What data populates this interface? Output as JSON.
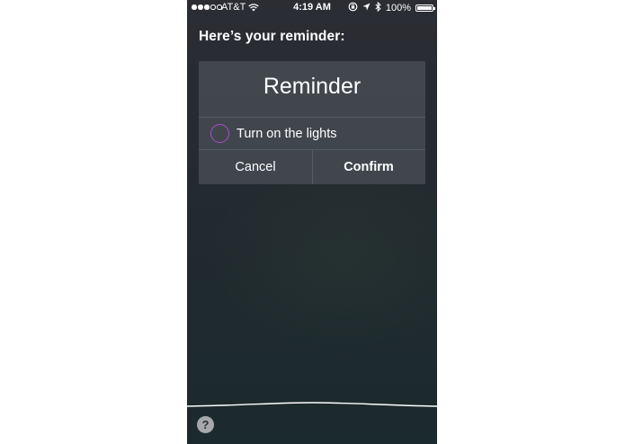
{
  "status_bar": {
    "carrier": "AT&T",
    "time": "4:19 AM",
    "battery": "100%",
    "signal_bars_filled": 3,
    "signal_bars_total": 5
  },
  "siri": {
    "prompt": "Here’s your reminder:"
  },
  "reminder_card": {
    "title": "Reminder",
    "item": "Turn on the lights",
    "cancel_label": "Cancel",
    "confirm_label": "Confirm"
  },
  "help": {
    "label": "?"
  },
  "colors": {
    "checkbox_ring": "#b24ad2",
    "background_top": "#2b2d33",
    "background_bottom": "#1b2a2d"
  },
  "icons": {
    "wifi": "wifi-icon",
    "orientation_lock": "orientation-lock-icon",
    "location": "location-arrow-icon",
    "bluetooth": "bluetooth-icon",
    "battery": "battery-icon",
    "help": "help-icon"
  }
}
